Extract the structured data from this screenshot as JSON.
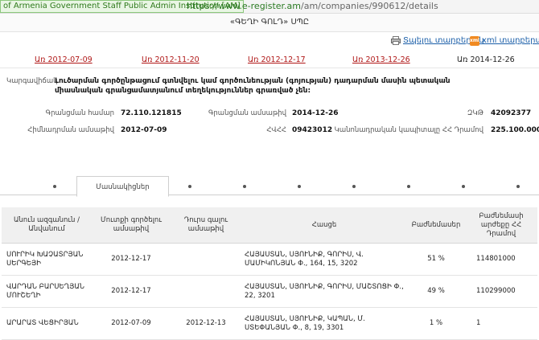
{
  "browser": {
    "cert_label": "of Armenia Government Staff Public Admin Institution [AM]",
    "url_host": "https://www.e-register.am",
    "url_path": "/am/companies/990612/details"
  },
  "page": {
    "title": "«ԳԵՂԻ ԳՈԼԴ» ՍՊԸ",
    "print_label": "Տպելու տարբերակ",
    "xml_label": "xml տարբերակ",
    "xml_icon_text": "xml"
  },
  "dates": [
    {
      "label": "Առ 2012-07-09",
      "current": false
    },
    {
      "label": "Առ 2012-11-20",
      "current": false
    },
    {
      "label": "Առ 2012-12-17",
      "current": false
    },
    {
      "label": "Առ 2013-12-26",
      "current": false
    },
    {
      "label": "Առ 2014-12-26",
      "current": true
    }
  ],
  "details": {
    "status_label": "Կարգավիճակ",
    "status_value": "Լուծարման գործընթացում գտնվելու կամ գործունեության (գոյության) դադարման մասին պետական միասնական գրանցամատյանում տեղեկություններ գրառված չեն:",
    "reg_number_label": "Գրանցման համար",
    "reg_number_value": "72.110.121815",
    "reg_date_label": "Գրանցման ամսաթիվ",
    "reg_date_value": "2014-12-26",
    "tin_label": "ՀՎՀՀ",
    "tin_value": "09423012",
    "zkp_label": "ԶԿԹ",
    "zkp_value": "42092377",
    "founding_date_label": "Հիմնադրման ամսաթիվ",
    "founding_date_value": "2012-07-09",
    "capital_label": "Կանոնադրական կապիտալը ՀՀ Դրամով",
    "capital_value": "225.100.000"
  },
  "tab": {
    "active_label": "Մասնակիցներ"
  },
  "table": {
    "headers": {
      "name": "Անուն ազգանուն / Անվանում",
      "entry_date": "Մուտքի գործելու ամսաթիվ",
      "exit_date": "Դուրս գալու ամսաթիվ",
      "address": "Հասցե",
      "shares": "Բաժնեմասեր",
      "value": "Բաժնեմասի արժեքը ՀՀ Դրամով"
    },
    "rows": [
      {
        "name": "ՍՈՒՐԻԿ ԽԱՉԱՏՐՅԱՆ ՍԵՐԳԵՅԻ",
        "entry_date": "2012-12-17",
        "exit_date": "",
        "address": "ՀԱՅԱՍՏԱՆ, ՍՅՈՒՆԻՔ, ԳՈՐԻՍ, Վ. ՄԱՄԻԿՈՆՅԱՆ Փ., 164, 15, 3202",
        "shares": "51 %",
        "value": "114801000"
      },
      {
        "name": "ՎԱՐԴԱՆ ԲԱՐՍԵՂՅԱՆ ՄՈՒՇԵՂԻ",
        "entry_date": "2012-12-17",
        "exit_date": "",
        "address": "ՀԱՅԱՍՏԱՆ, ՍՅՈՒՆԻՔ, ԳՈՐԻՍ, ՄԱՇՏՈՑԻ Փ., 22, 3201",
        "shares": "49 %",
        "value": "110299000"
      },
      {
        "name": "ԱՐԱՐԱՏ ՎԵՑԻՐՅԱՆ",
        "entry_date": "2012-07-09",
        "exit_date": "2012-12-13",
        "address": "ՀԱՅԱՍՏԱՆ, ՍՅՈՒՆԻՔ, ԿԱՊԱՆ, Մ. ՍՏԵՓԱՆՅԱՆ Փ., 8, 19, 3301",
        "shares": "1 %",
        "value": "1"
      }
    ]
  }
}
